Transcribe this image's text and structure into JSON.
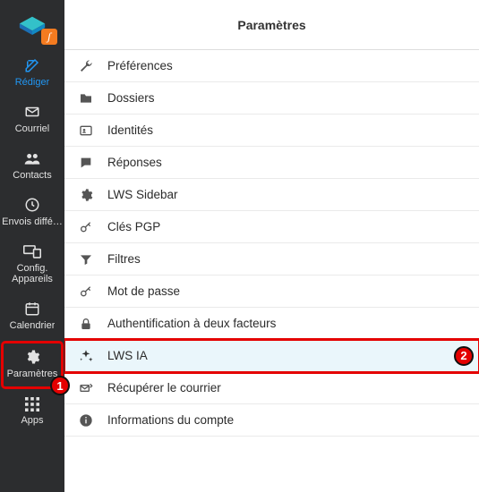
{
  "header": {
    "title": "Paramètres"
  },
  "sidebar": {
    "items": [
      {
        "label": "Rédiger",
        "icon": "compose-icon"
      },
      {
        "label": "Courriel",
        "icon": "mail-icon"
      },
      {
        "label": "Contacts",
        "icon": "contacts-icon"
      },
      {
        "label": "Envois diffé…",
        "icon": "clock-icon"
      },
      {
        "label": "Config. Appareils",
        "icon": "devices-icon"
      },
      {
        "label": "Calendrier",
        "icon": "calendar-icon"
      },
      {
        "label": "Paramètres",
        "icon": "gear-icon"
      },
      {
        "label": "Apps",
        "icon": "apps-grid-icon"
      }
    ]
  },
  "settings": {
    "items": [
      {
        "label": "Préférences",
        "icon": "wrench-icon"
      },
      {
        "label": "Dossiers",
        "icon": "folder-icon"
      },
      {
        "label": "Identités",
        "icon": "id-card-icon"
      },
      {
        "label": "Réponses",
        "icon": "speech-icon"
      },
      {
        "label": "LWS Sidebar",
        "icon": "cog-icon"
      },
      {
        "label": "Clés PGP",
        "icon": "key-icon"
      },
      {
        "label": "Filtres",
        "icon": "filter-icon"
      },
      {
        "label": "Mot de passe",
        "icon": "key-icon"
      },
      {
        "label": "Authentification à deux facteurs",
        "icon": "lock-icon"
      },
      {
        "label": "LWS IA",
        "icon": "sparkle-icon"
      },
      {
        "label": "Récupérer le courrier",
        "icon": "retrieve-icon"
      },
      {
        "label": "Informations du compte",
        "icon": "info-icon"
      }
    ]
  },
  "callouts": {
    "sidebar_settings": "1",
    "lws_ia": "2"
  },
  "colors": {
    "accent": "#2196f3",
    "highlight": "#e40000",
    "selected_bg": "#eaf6fb"
  }
}
